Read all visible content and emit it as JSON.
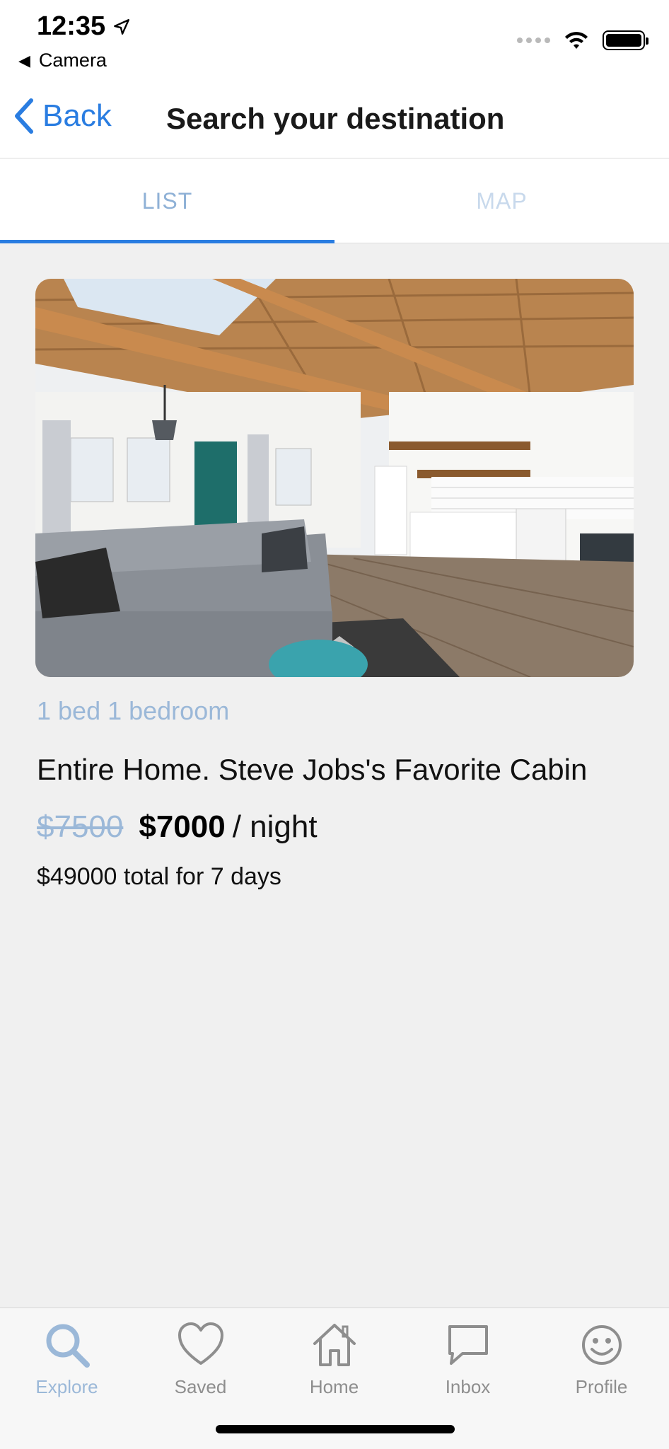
{
  "status_bar": {
    "time": "12:35",
    "back_app": "Camera",
    "icons": [
      "location-arrow-icon",
      "signal-dots-icon",
      "wifi-icon",
      "battery-icon"
    ]
  },
  "nav": {
    "back_label": "Back",
    "title": "Search your destination"
  },
  "tabs": [
    {
      "label": "LIST",
      "active": true
    },
    {
      "label": "MAP",
      "active": false
    }
  ],
  "listing": {
    "meta": "1 bed 1 bedroom",
    "title": "Entire Home. Steve Jobs's Favorite Cabin",
    "old_price": "$7500",
    "new_price": "$7000",
    "per_night": "/ night",
    "total": "$49000 total for 7 days"
  },
  "bottom_nav": [
    {
      "label": "Explore",
      "icon": "search-icon",
      "active": true
    },
    {
      "label": "Saved",
      "icon": "heart-icon",
      "active": false
    },
    {
      "label": "Home",
      "icon": "house-icon",
      "active": false
    },
    {
      "label": "Inbox",
      "icon": "chat-bubble-icon",
      "active": false
    },
    {
      "label": "Profile",
      "icon": "smiley-icon",
      "active": false
    }
  ],
  "colors": {
    "accent": "#2a7de1",
    "muted_blue": "#9bb8d8",
    "background": "#f0f0f0"
  }
}
